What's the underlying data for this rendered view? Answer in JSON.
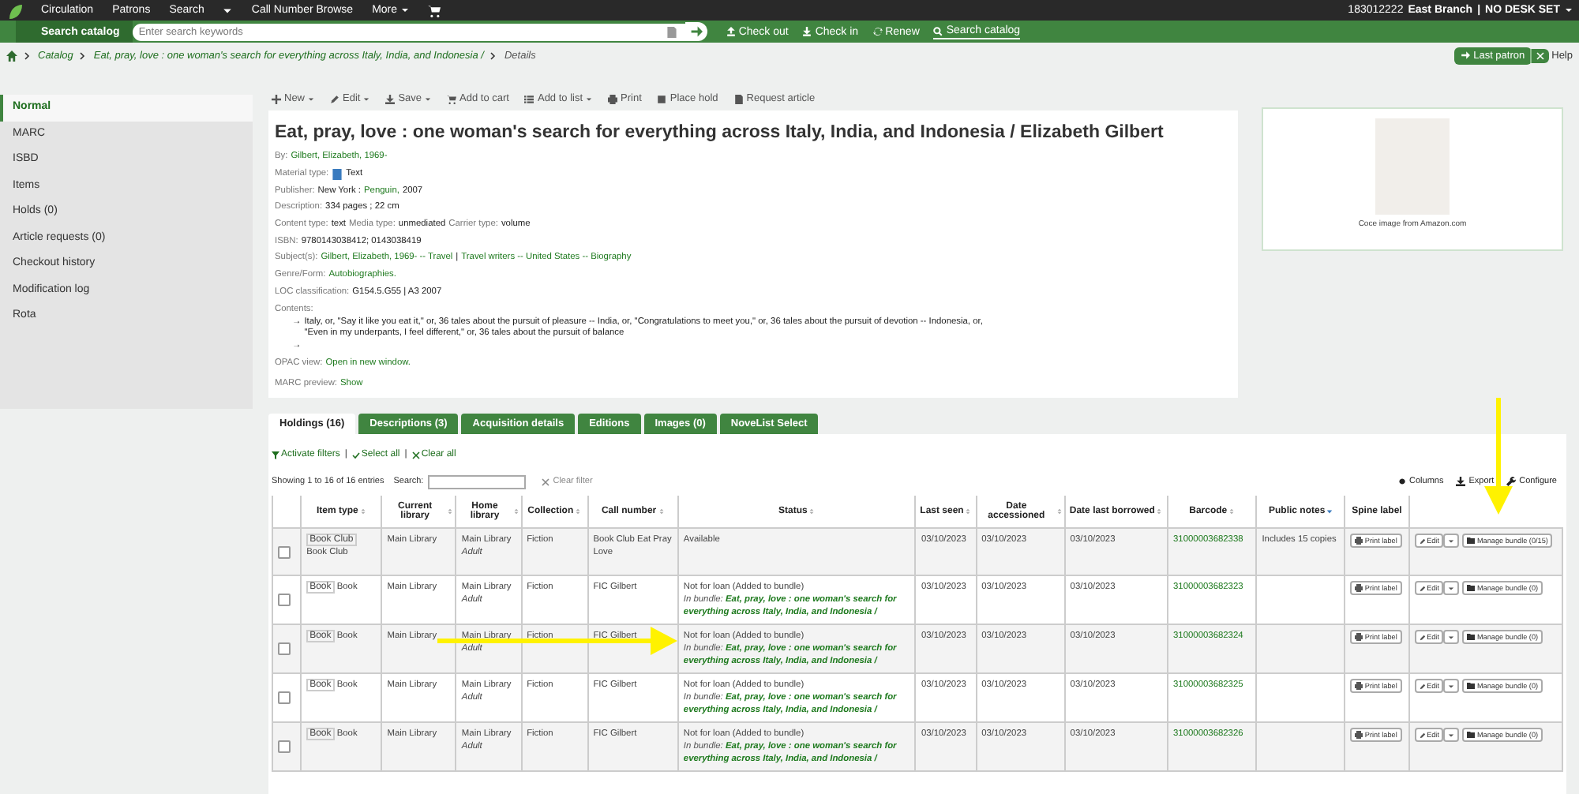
{
  "top_nav": {
    "items": [
      {
        "kind": "link",
        "label": "Circulation"
      },
      {
        "kind": "link",
        "label": "Patrons"
      },
      {
        "kind": "link",
        "label": "Search"
      },
      {
        "kind": "caret"
      },
      {
        "kind": "link",
        "label": "Call Number Browse"
      },
      {
        "kind": "menu",
        "label": "More"
      },
      {
        "kind": "cart"
      }
    ],
    "user": {
      "login": "183012222",
      "branch": "East Branch",
      "separator": "|",
      "desk": "NO DESK SET"
    }
  },
  "search_bar": {
    "scope": "Search catalog",
    "placeholder": "Enter search keywords",
    "links": [
      {
        "label": "Check out",
        "selected": false
      },
      {
        "label": "Check in",
        "selected": false
      },
      {
        "label": "Renew",
        "selected": false
      },
      {
        "label": "Search catalog",
        "selected": true
      }
    ]
  },
  "breadcrumbs": [
    {
      "kind": "link",
      "label": "Catalog"
    },
    {
      "kind": "link",
      "label": "Eat, pray, love : one woman's search for everything across Italy, India, and Indonesia /"
    },
    {
      "kind": "current",
      "label": "Details"
    }
  ],
  "header_buttons": {
    "last_patron": "Last patron",
    "help": "Help"
  },
  "sidebar": {
    "items": [
      {
        "label": "Normal",
        "selected": true
      },
      {
        "label": "MARC",
        "selected": false
      },
      {
        "label": "ISBD",
        "selected": false
      },
      {
        "label": "Items",
        "selected": false
      },
      {
        "label": "Holds (0)",
        "selected": false
      },
      {
        "label": "Article requests (0)",
        "selected": false
      },
      {
        "label": "Checkout history",
        "selected": false
      },
      {
        "label": "Modification log",
        "selected": false
      },
      {
        "label": "Rota",
        "selected": false
      }
    ]
  },
  "toolbar": [
    {
      "label": "New",
      "menu": true
    },
    {
      "label": "Edit",
      "menu": true
    },
    {
      "label": "Save",
      "menu": true
    },
    {
      "label": "Add to cart",
      "menu": false
    },
    {
      "label": "Add to list",
      "menu": true
    },
    {
      "label": "Print",
      "menu": false
    },
    {
      "label": "Place hold",
      "menu": false
    },
    {
      "label": "Request article",
      "menu": false
    }
  ],
  "record": {
    "title": "Eat, pray, love : one woman's search for everything across Italy, India, and Indonesia / Elizabeth Gilbert",
    "fields": [
      [
        {
          "kind": "label",
          "text": "By:"
        },
        {
          "kind": "link",
          "text": "Gilbert, Elizabeth, 1969-"
        }
      ],
      [
        {
          "kind": "label",
          "text": "Material type:"
        },
        {
          "kind": "icon"
        },
        {
          "kind": "value",
          "text": "Text"
        }
      ],
      [
        {
          "kind": "label",
          "text": "Publisher:"
        },
        {
          "kind": "value",
          "text": "New York :"
        },
        {
          "kind": "link",
          "text": "Penguin,"
        },
        {
          "kind": "value",
          "text": "2007"
        }
      ],
      [
        {
          "kind": "label",
          "text": "Description:"
        },
        {
          "kind": "value",
          "text": "334 pages ; 22 cm"
        }
      ],
      [
        {
          "kind": "label",
          "text": "Content type:"
        },
        {
          "kind": "value",
          "text": "text"
        },
        {
          "kind": "label",
          "text": "Media type:"
        },
        {
          "kind": "value",
          "text": "unmediated"
        },
        {
          "kind": "label",
          "text": "Carrier type:"
        },
        {
          "kind": "value",
          "text": "volume"
        }
      ],
      [
        {
          "kind": "label",
          "text": "ISBN:"
        },
        {
          "kind": "value",
          "text": "9780143038412; 0143038419"
        }
      ],
      [
        {
          "kind": "label",
          "text": "Subject(s):"
        },
        {
          "kind": "link",
          "text": "Gilbert, Elizabeth, 1969- -- Travel"
        },
        {
          "kind": "value",
          "text": "|"
        },
        {
          "kind": "link",
          "text": "Travel writers -- United States -- Biography"
        }
      ],
      [
        {
          "kind": "label",
          "text": "Genre/Form:"
        },
        {
          "kind": "link",
          "text": "Autobiographies."
        }
      ],
      [
        {
          "kind": "label",
          "text": "LOC classification:"
        },
        {
          "kind": "value",
          "text": "G154.5.G55 | A3 2007"
        }
      ]
    ],
    "contents_label": "Contents:",
    "contents": [
      {
        "arrow": "→",
        "text": "Italy, or, \"Say it like you eat it,\" or, 36 tales about the pursuit of pleasure -- India, or, \"Congratulations to meet you,\" or, 36 tales about the pursuit of devotion -- Indonesia, or, \"Even in my underpants, I feel different,\" or, 36 tales about the pursuit of balance"
      },
      {
        "arrow": "→"
      }
    ],
    "links": [
      [
        {
          "kind": "label",
          "text": "OPAC view:"
        },
        {
          "kind": "link",
          "text": "Open in new window."
        }
      ],
      [
        {
          "kind": "label",
          "text": "MARC preview:"
        },
        {
          "kind": "link",
          "text": "Show"
        }
      ]
    ]
  },
  "cover": {
    "caption": "Coce image from Amazon.com"
  },
  "tabs": [
    {
      "label": "Holdings (16)",
      "selected": true
    },
    {
      "label": "Descriptions (3)",
      "selected": false
    },
    {
      "label": "Acquisition details",
      "selected": false
    },
    {
      "label": "Editions",
      "selected": false
    },
    {
      "label": "Images (0)",
      "selected": false
    },
    {
      "label": "NoveList Select",
      "selected": false
    }
  ],
  "holdings": {
    "filter_links": [
      {
        "kind": "filter",
        "label": "Activate filters"
      },
      {
        "kind": "select",
        "label": "Select all"
      },
      {
        "kind": "clear",
        "label": "Clear all"
      }
    ],
    "separator": "|",
    "info": "Showing 1 to 16 of 16 entries",
    "search_label": "Search:",
    "clear_filter": "Clear filter",
    "tools": [
      "Columns",
      "Export",
      "Configure"
    ],
    "columns": [
      {
        "label": "Item type",
        "sortable": true,
        "sorted_desc": false
      },
      {
        "label": "Current library",
        "sortable": true,
        "sorted_desc": false
      },
      {
        "label": "Home library",
        "sortable": true,
        "sorted_desc": false
      },
      {
        "label": "Collection",
        "sortable": true,
        "sorted_desc": false
      },
      {
        "label": "Call number",
        "sortable": true,
        "sorted_desc": false
      },
      {
        "label": "Status",
        "sortable": true,
        "sorted_desc": false
      },
      {
        "label": "Last seen",
        "sortable": true,
        "sorted_desc": false
      },
      {
        "label": "Date accessioned",
        "sortable": true,
        "sorted_desc": false
      },
      {
        "label": "Date last borrowed",
        "sortable": true,
        "sorted_desc": false
      },
      {
        "label": "Barcode",
        "sortable": true,
        "sorted_desc": false
      },
      {
        "label": "Public notes",
        "sortable": true,
        "sorted_desc": true
      },
      {
        "label": "Spine label",
        "sortable": false
      }
    ],
    "rows": [
      {
        "checked": false,
        "image_alt": "Book Club",
        "item_type": "Book Club",
        "current_library": "Main Library",
        "home_library": "Main Library",
        "location": "Adult",
        "collection": "Fiction",
        "call_number": "Book Club Eat Pray Love",
        "status": "Available",
        "last_seen": "03/10/2023",
        "date_accessioned": "03/10/2023",
        "date_last_borrowed": "03/10/2023",
        "barcode": "31000003682338",
        "public_notes": "Includes 15 copies",
        "print_label": "Print label",
        "edit": "Edit",
        "manage_bundle": "Manage bundle (0/15)"
      },
      {
        "checked": false,
        "image_alt": "Book",
        "item_type": "Book",
        "current_library": "Main Library",
        "home_library": "Main Library",
        "location": "Adult",
        "collection": "Fiction",
        "call_number": "FIC Gilbert",
        "status": "Not for loan (Added to bundle)",
        "bundle": "In bundle: **Eat, pray, love : one woman's search for everything across Italy, India, and Indonesia /**",
        "last_seen": "03/10/2023",
        "date_accessioned": "03/10/2023",
        "date_last_borrowed": "03/10/2023",
        "barcode": "31000003682323",
        "print_label": "Print label",
        "edit": "Edit",
        "manage_bundle": "Manage bundle (0)"
      },
      {
        "checked": false,
        "image_alt": "Book",
        "item_type": "Book",
        "current_library": "Main Library",
        "home_library": "Main Library",
        "location": "Adult",
        "collection": "Fiction",
        "call_number": "FIC Gilbert",
        "status": "Not for loan (Added to bundle)",
        "bundle": "In bundle: **Eat, pray, love : one woman's search for everything across Italy, India, and Indonesia /**",
        "last_seen": "03/10/2023",
        "date_accessioned": "03/10/2023",
        "date_last_borrowed": "03/10/2023",
        "barcode": "31000003682324",
        "print_label": "Print label",
        "edit": "Edit",
        "manage_bundle": "Manage bundle (0)"
      },
      {
        "checked": false,
        "image_alt": "Book",
        "item_type": "Book",
        "current_library": "Main Library",
        "home_library": "Main Library",
        "location": "Adult",
        "collection": "Fiction",
        "call_number": "FIC Gilbert",
        "status": "Not for loan (Added to bundle)",
        "bundle": "In bundle: **Eat, pray, love : one woman's search for everything across Italy, India, and Indonesia /**",
        "last_seen": "03/10/2023",
        "date_accessioned": "03/10/2023",
        "date_last_borrowed": "03/10/2023",
        "barcode": "31000003682325",
        "print_label": "Print label",
        "edit": "Edit",
        "manage_bundle": "Manage bundle (0)"
      },
      {
        "checked": false,
        "image_alt": "Book",
        "item_type": "Book",
        "current_library": "Main Library",
        "home_library": "Main Library",
        "location": "Adult",
        "collection": "Fiction",
        "call_number": "FIC Gilbert",
        "status": "Not for loan (Added to bundle)",
        "bundle": "In bundle: **Eat, pray, love : one woman's search for everything across Italy, India, and Indonesia /**",
        "last_seen": "03/10/2023",
        "date_accessioned": "03/10/2023",
        "date_last_borrowed": "03/10/2023",
        "barcode": "31000003682326",
        "print_label": "Print label",
        "edit": "Edit",
        "manage_bundle": "Manage bundle (0)"
      }
    ]
  },
  "annotation_arrows": [
    {
      "vertical": true
    },
    {
      "vertical": false
    }
  ]
}
